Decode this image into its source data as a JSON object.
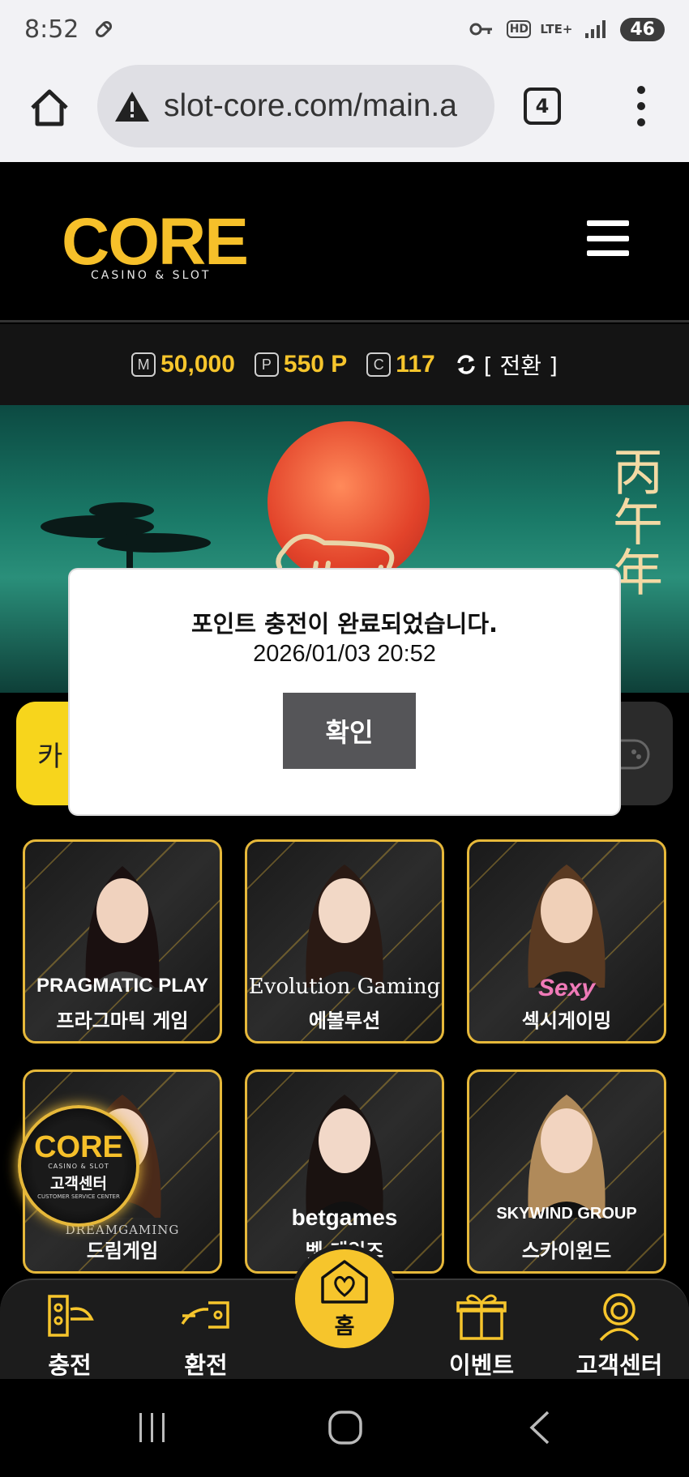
{
  "status_bar": {
    "time": "8:52",
    "network": "LTE+",
    "hd": "HD",
    "battery": "46"
  },
  "browser": {
    "url": "slot-core.com/main.a",
    "tab_count": "4"
  },
  "site": {
    "logo_main": "CORE",
    "logo_sub": "CASINO & SLOT"
  },
  "balance": {
    "money_tag": "M",
    "money": "50,000",
    "point_tag": "P",
    "point": "550 P",
    "comp_tag": "C",
    "comp": "117",
    "convert_label": "[ 전환 ]"
  },
  "banner": {
    "chars": "丙午年"
  },
  "category": {
    "left_partial": "카"
  },
  "games": [
    {
      "brand": "PRAGMATIC PLAY",
      "label": "프라그마틱 게임"
    },
    {
      "brand": "Evolution Gaming",
      "label": "에볼루션"
    },
    {
      "brand": "Sexy",
      "label": "섹시게이밍"
    },
    {
      "brand": "DREAMGAMING",
      "label": "드림게임"
    },
    {
      "brand": "betgames",
      "label": "벳 게임즈"
    },
    {
      "brand": "SKYWIND GROUP",
      "label": "스카이윈드"
    }
  ],
  "cs_badge": {
    "logo": "CORE",
    "sub": "CASINO & SLOT",
    "label": "고객센터",
    "foot": "CUSTOMER SERVICE CENTER"
  },
  "bottom_nav": {
    "charge": "충전",
    "exchange": "환전",
    "home": "홈",
    "event": "이벤트",
    "support": "고객센터"
  },
  "dialog": {
    "message": "포인트 충전이 완료되었습니다.",
    "time": "2026/01/03 20:52",
    "confirm": "확인"
  },
  "colors": {
    "accent_gold": "#f6c52c",
    "logo_blue": "#19a9d6",
    "dialog_button": "#555558"
  }
}
